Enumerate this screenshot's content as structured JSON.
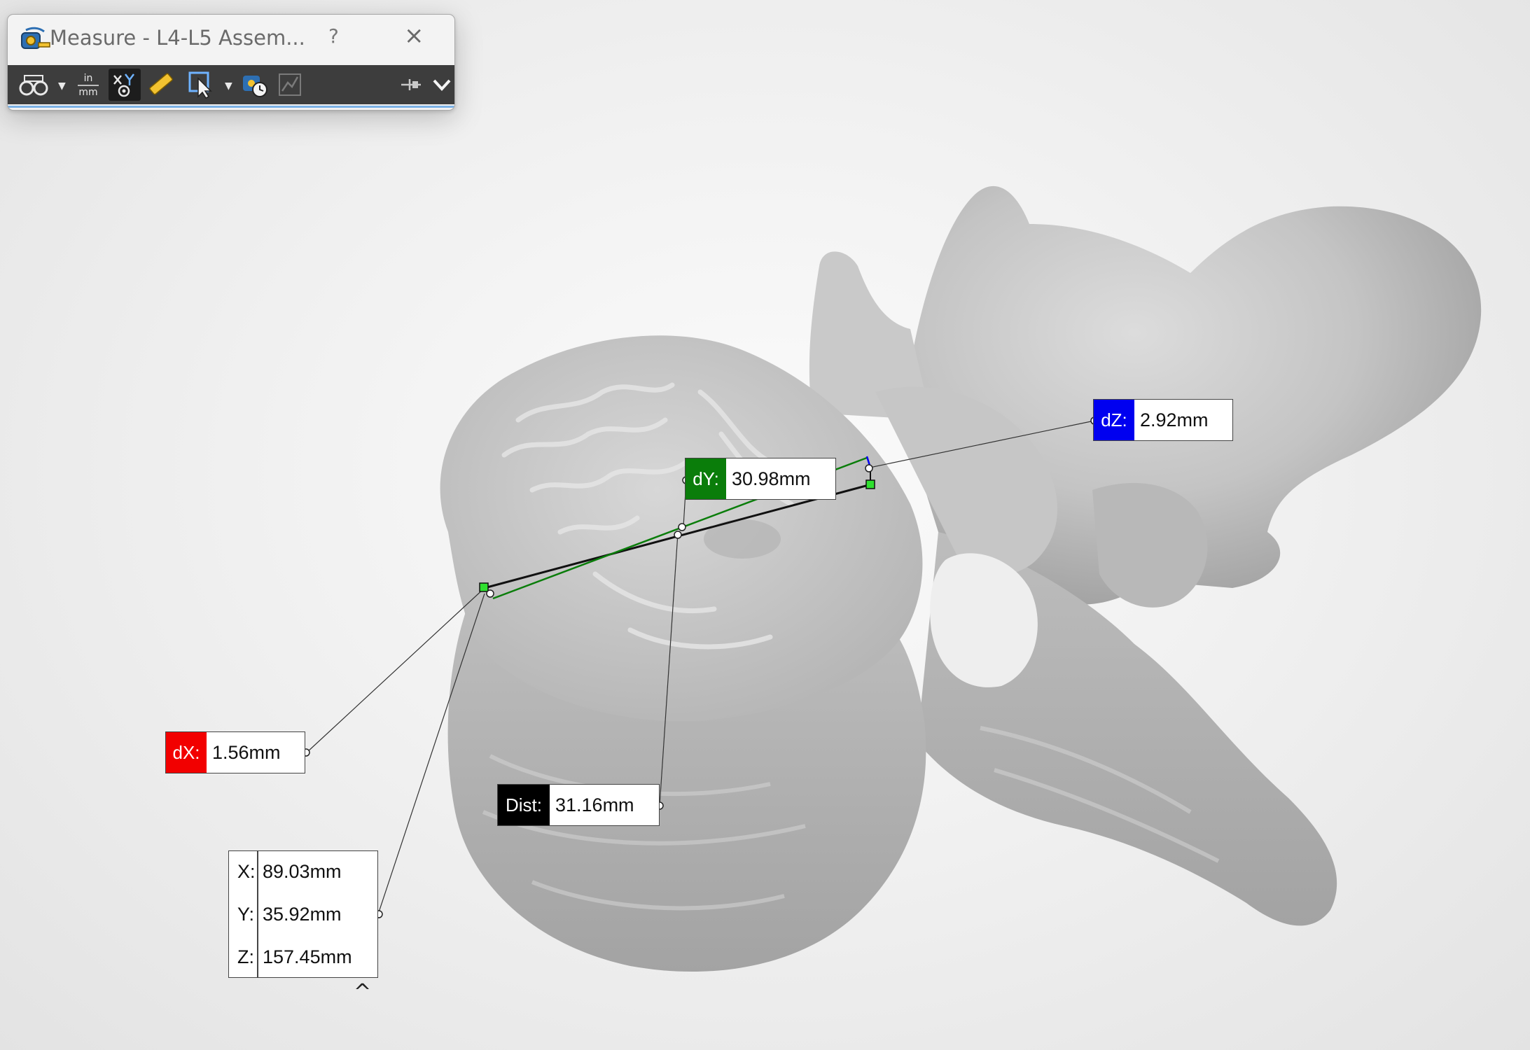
{
  "dialog": {
    "title": "Measure - L4-L5 Assem...",
    "help_label": "?",
    "close_label": "×",
    "toolbar_icons": [
      "arc-circle-measurement-icon",
      "units-precision-icon",
      "xyz-measurement-icon",
      "point-to-point-icon",
      "selection-filter-icon",
      "measurement-history-icon",
      "create-sensor-icon",
      "pin-icon",
      "expand-chevron-icon"
    ],
    "units_icon_text": {
      "top": "in",
      "bottom": "mm"
    }
  },
  "measurements": {
    "dx": {
      "label": "dX:",
      "value": "1.56mm",
      "color": "#f20000"
    },
    "dy": {
      "label": "dY:",
      "value": "30.98mm",
      "color": "#0a7d0a"
    },
    "dz": {
      "label": "dZ:",
      "value": "2.92mm",
      "color": "#0000f0"
    },
    "dist": {
      "label": "Dist:",
      "value": "31.16mm",
      "color": "#000000"
    }
  },
  "point_coords": {
    "x": {
      "label": "X:",
      "value": "89.03mm"
    },
    "y": {
      "label": "Y:",
      "value": "35.92mm"
    },
    "z": {
      "label": "Z:",
      "value": "157.45mm"
    }
  },
  "collapse_label": "^",
  "model": {
    "name": "vertebra-model",
    "color": "#c2c2c2"
  }
}
